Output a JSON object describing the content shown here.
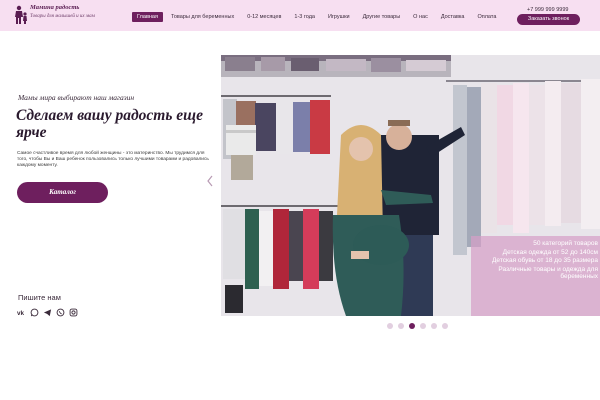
{
  "brand": {
    "name": "Мамина радость",
    "tagline": "Товары для малышей и их мам"
  },
  "nav": {
    "items": [
      {
        "label": "Главная",
        "active": true
      },
      {
        "label": "Товары для беременных",
        "active": false
      },
      {
        "label": "0-12 месяцев",
        "active": false
      },
      {
        "label": "1-3 года",
        "active": false
      },
      {
        "label": "Игрушки",
        "active": false
      },
      {
        "label": "Другие товары",
        "active": false
      },
      {
        "label": "О нас",
        "active": false
      },
      {
        "label": "Доставка",
        "active": false
      },
      {
        "label": "Оплата",
        "active": false
      }
    ]
  },
  "contact": {
    "phone": "+7 999 999 9999",
    "callback_label": "Заказать звонок"
  },
  "hero": {
    "eyebrow": "Мамы мира выбирают наш магазин",
    "title": "Сделаем вашу радость еще ярче",
    "description": "Самое счастливое время для любой женщины - это материнство. Мы трудимся для того, чтобы Вы и Ваш ребенок пользовались только лучшими товарами и радовались каждому моменту.",
    "cta_label": "Каталог"
  },
  "slider": {
    "overlay": [
      "50 категорий товаров",
      "Детская одежда от 52 до 140см",
      "Детская обувь от 18 до 35 размера",
      "Различные товары и одежда для беременных"
    ],
    "dots": [
      {
        "active": false
      },
      {
        "active": false
      },
      {
        "active": true
      },
      {
        "active": false
      },
      {
        "active": false
      },
      {
        "active": false
      }
    ],
    "prev_icon": "chevron-left-icon"
  },
  "social": {
    "title": "Пишите нам",
    "icons": [
      "vk-icon",
      "whatsapp-icon",
      "telegram-icon",
      "viber-icon",
      "instagram-icon"
    ]
  },
  "colors": {
    "accent": "#6e1f5e",
    "header_bg": "#f7dff1",
    "overlay_bg": "#d6a0c8"
  }
}
